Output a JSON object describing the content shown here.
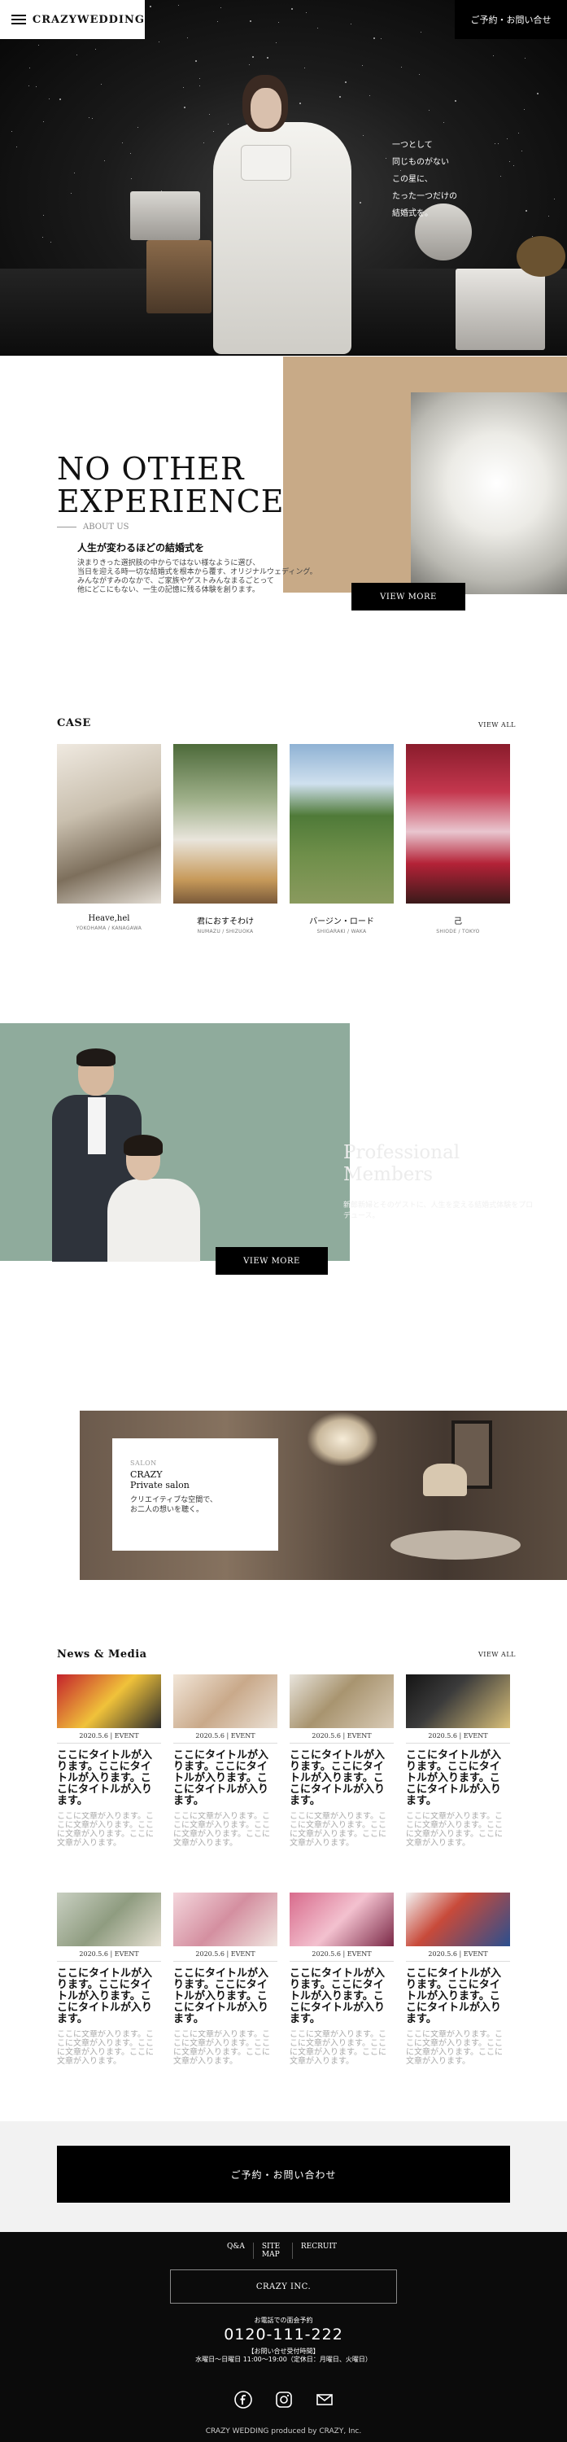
{
  "header": {
    "brand": "CRAZYWEDDING",
    "contact_button": "ご予約・お問い合せ"
  },
  "hero": {
    "copy_lines": [
      "一つとして",
      "同じものがない",
      "この星に、",
      "たった一つだけの",
      "結婚式を。"
    ]
  },
  "about": {
    "title_line1": "NO OTHER",
    "title_line2": "EXPERIENCE",
    "label": "ABOUT US",
    "subtitle": "人生が変わるほどの結婚式を",
    "body_lines": [
      "決まりきった選択肢の中からではない様なように選び、",
      "当日を迎える時一切な結婚式を根本から覆す、オリジナルウェディング。",
      "みんながすみのなかで、ご家族やゲストみんなまるごとって",
      "他にどこにもない、一生の記憶に残る体験を創ります。"
    ],
    "button": "VIEW MORE"
  },
  "case": {
    "title": "CASE",
    "view_all": "VIEW ALL",
    "items": [
      {
        "name": "Heave,hel",
        "location": "YOKOHAMA / KANAGAWA"
      },
      {
        "name": "君におすそわけ",
        "location": "NUMAZU / SHIZUOKA"
      },
      {
        "name": "バージン・ロード",
        "location": "SHIGARAKI / WAKA"
      },
      {
        "name": "己",
        "location": "SHIODE / TOKYO"
      }
    ]
  },
  "members": {
    "button": "VIEW MORE",
    "ghost_title_1": "Professional",
    "ghost_title_2": "Members",
    "ghost_text": "新郎新婦とそのゲストに、人生を変える結婚式体験をプロデュース。"
  },
  "salon": {
    "label": "SALON",
    "title_1": "CRAZY",
    "title_2": "Private salon",
    "desc_1": "クリエイティブな空間で、",
    "desc_2": "お二人の想いを聴く。"
  },
  "news": {
    "title": "News & Media",
    "view_all": "VIEW ALL",
    "items": [
      {
        "date": "2020.5.6 | EVENT",
        "title": "ここにタイトルが入ります。ここにタイトルが入ります。ここにタイトルが入ります。",
        "body": "ここに文章が入ります。ここに文章が入ります。ここに文章が入ります。ここに文章が入ります。"
      },
      {
        "date": "2020.5.6 | EVENT",
        "title": "ここにタイトルが入ります。ここにタイトルが入ります。ここにタイトルが入ります。",
        "body": "ここに文章が入ります。ここに文章が入ります。ここに文章が入ります。ここに文章が入ります。"
      },
      {
        "date": "2020.5.6 | EVENT",
        "title": "ここにタイトルが入ります。ここにタイトルが入ります。ここにタイトルが入ります。",
        "body": "ここに文章が入ります。ここに文章が入ります。ここに文章が入ります。ここに文章が入ります。"
      },
      {
        "date": "2020.5.6 | EVENT",
        "title": "ここにタイトルが入ります。ここにタイトルが入ります。ここにタイトルが入ります。",
        "body": "ここに文章が入ります。ここに文章が入ります。ここに文章が入ります。ここに文章が入ります。"
      },
      {
        "date": "2020.5.6 | EVENT",
        "title": "ここにタイトルが入ります。ここにタイトルが入ります。ここにタイトルが入ります。",
        "body": "ここに文章が入ります。ここに文章が入ります。ここに文章が入ります。ここに文章が入ります。"
      },
      {
        "date": "2020.5.6 | EVENT",
        "title": "ここにタイトルが入ります。ここにタイトルが入ります。ここにタイトルが入ります。",
        "body": "ここに文章が入ります。ここに文章が入ります。ここに文章が入ります。ここに文章が入ります。"
      },
      {
        "date": "2020.5.6 | EVENT",
        "title": "ここにタイトルが入ります。ここにタイトルが入ります。ここにタイトルが入ります。",
        "body": "ここに文章が入ります。ここに文章が入ります。ここに文章が入ります。ここに文章が入ります。"
      },
      {
        "date": "2020.5.6 | EVENT",
        "title": "ここにタイトルが入ります。ここにタイトルが入ります。ここにタイトルが入ります。",
        "body": "ここに文章が入ります。ここに文章が入ります。ここに文章が入ります。ここに文章が入ります。"
      }
    ]
  },
  "contact": {
    "button": "ご予約・お問い合わせ"
  },
  "footer": {
    "nav": [
      "Q&A",
      "SITE MAP",
      "RECRUIT"
    ],
    "company_button": "CRAZY INC.",
    "tel_label": "お電話での面会予約",
    "tel": "0120-111-222",
    "hours_1": "【お問い合せ受付時間】",
    "hours_2": "水曜日〜日曜日 11:00〜19:00（定休日：月曜日、火曜日）",
    "copyright": "CRAZY WEDDING produced by CRAZY, Inc.",
    "social_icons": [
      "facebook-icon",
      "instagram-icon",
      "mail-icon"
    ]
  },
  "colors": {
    "accent_beige": "#c8aa87",
    "members_green": "#8fab9c",
    "black": "#000000"
  }
}
